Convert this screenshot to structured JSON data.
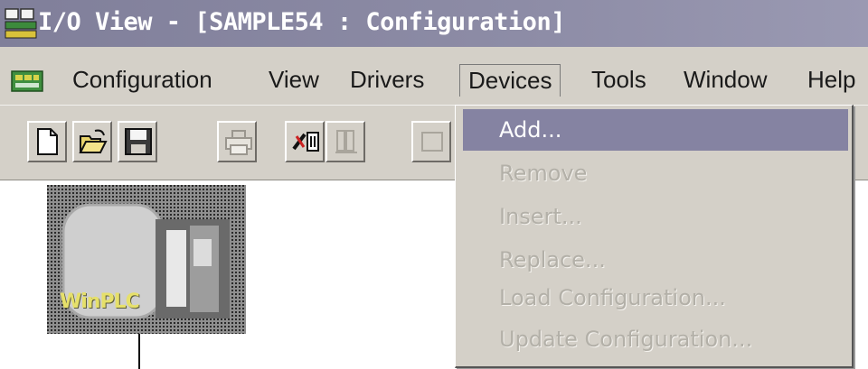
{
  "window": {
    "title": "I/O View - [SAMPLE54 : Configuration]",
    "app_icon": "io-view-icon"
  },
  "menubar": {
    "icon": "configuration-menu-icon",
    "items": [
      "Configuration",
      "View",
      "Drivers",
      "Devices",
      "Tools",
      "Window",
      "Help"
    ],
    "open_menu": "Devices"
  },
  "toolbar": {
    "buttons": [
      {
        "name": "new-document-icon",
        "enabled": true
      },
      {
        "name": "open-folder-icon",
        "enabled": true
      },
      {
        "name": "save-disk-icon",
        "enabled": true
      },
      {
        "name": "print-icon",
        "enabled": false
      },
      {
        "name": "connect-device-icon",
        "enabled": true
      },
      {
        "name": "module-icon",
        "enabled": false
      },
      {
        "name": "frame-icon",
        "enabled": false
      }
    ]
  },
  "workspace": {
    "device_label": "WinPLC"
  },
  "devices_menu": {
    "items": [
      {
        "label": "Add...",
        "enabled": true,
        "highlighted": true
      },
      {
        "label": "Remove",
        "enabled": false
      },
      {
        "label": "Insert...",
        "enabled": false
      },
      {
        "label": "Replace...",
        "enabled": false
      },
      {
        "label": "Load Configuration...",
        "enabled": false
      },
      {
        "label": "Update Configuration...",
        "enabled": false
      }
    ]
  },
  "colors": {
    "titlebar": "#8a89a3",
    "highlight": "#8583a2",
    "face": "#d4d0c8",
    "disabled_text": "#b3b0a8"
  }
}
